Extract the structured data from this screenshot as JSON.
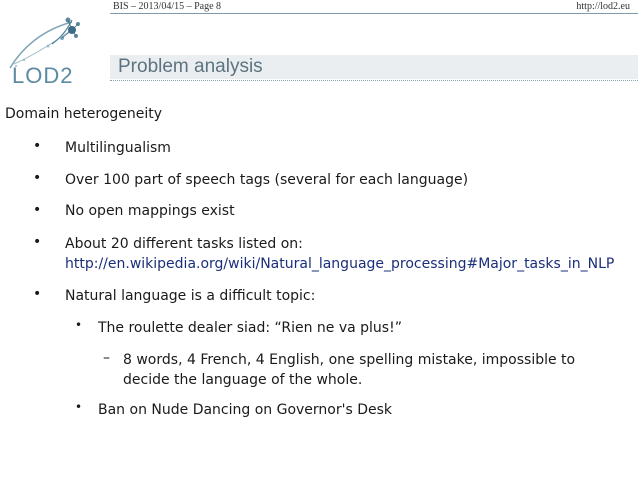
{
  "header": {
    "meta": "BIS  –  2013/04/15  –  Page 8",
    "url": "http://lod2.eu"
  },
  "logo": {
    "text": "LOD2"
  },
  "title": "Problem analysis",
  "content": {
    "heading": "Domain heterogeneity",
    "bullets": [
      "Multilingualism",
      "Over 100 part of speech tags (several for each language)",
      "No open mappings exist",
      "About 20 different tasks listed on:",
      "Natural language is a difficult topic:"
    ],
    "link": "http://en.wikipedia.org/wiki/Natural_language_processing#Major_tasks_in_NLP",
    "sub_bullets": [
      "The roulette dealer siad: “Rien ne va plus!”",
      "Ban on Nude Dancing on Governor's Desk"
    ],
    "detail_line1": "8 words, 4 French, 4 English, one spelling mistake, impossible to",
    "detail_line2": "decide the language of the whole."
  },
  "colors": {
    "title": "#5d7380",
    "link": "#1a2f7a",
    "title_bg": "#eaeef0"
  }
}
